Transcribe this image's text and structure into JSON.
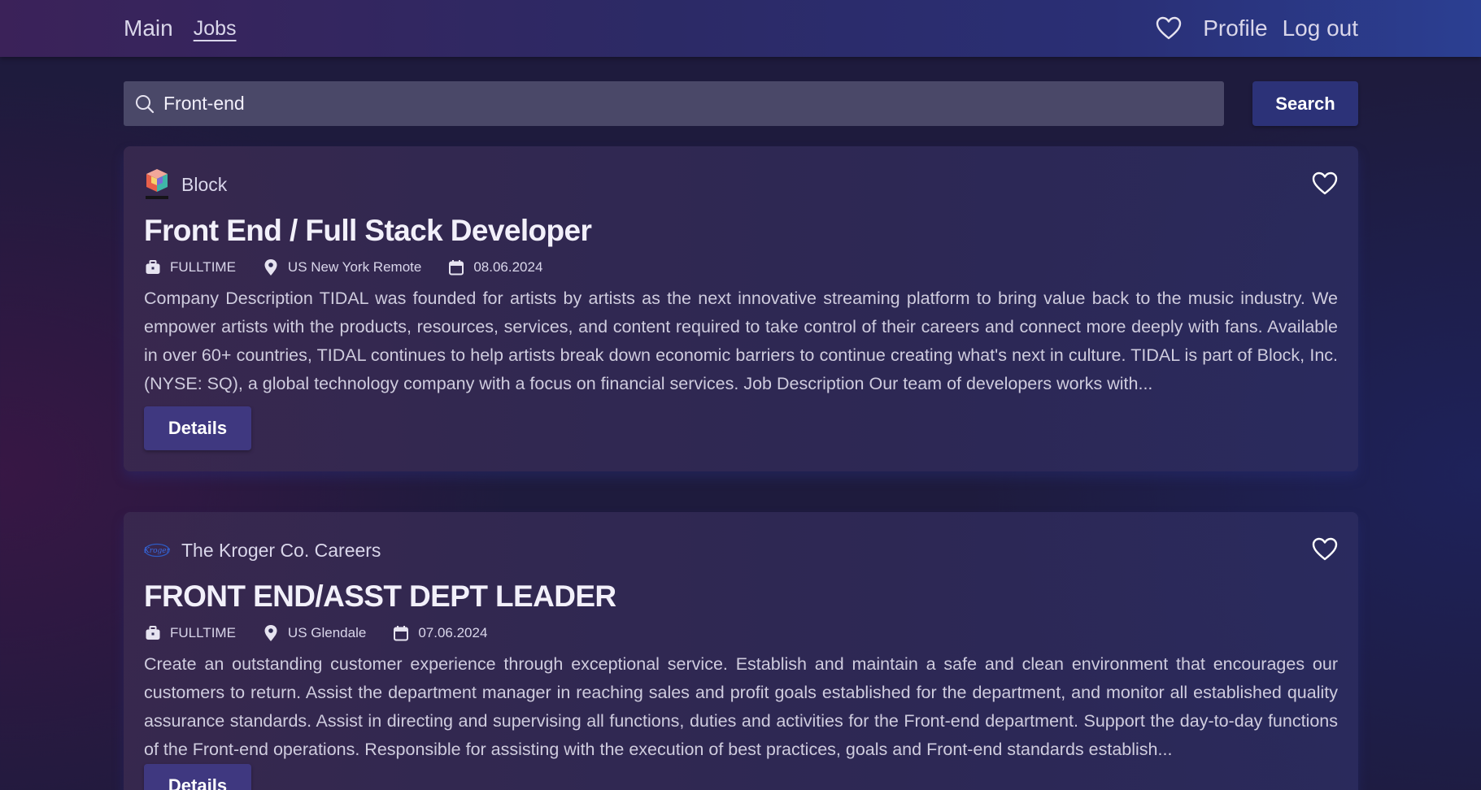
{
  "nav": {
    "main_label": "Main",
    "jobs_label": "Jobs",
    "favorites_icon": "heart-icon",
    "profile_label": "Profile",
    "logout_label": "Log out"
  },
  "search": {
    "value": "Front-end",
    "icon": "search-icon",
    "button_label": "Search"
  },
  "jobs": [
    {
      "company": "Block",
      "logo": "block-logo",
      "title": "Front End / Full Stack Developer",
      "employment_type": "FULLTIME",
      "location": "US New York Remote",
      "date": "08.06.2024",
      "description": "Company Description TIDAL was founded for artists by artists as the next innovative streaming platform to bring value back to the music industry. We empower artists with the products, resources, services, and content required to take control of their careers and connect more deeply with fans. Available in over 60+ countries, TIDAL continues to help artists break down economic barriers to continue creating what's next in culture. TIDAL is part of Block, Inc. (NYSE: SQ), a global technology company with a focus on financial services. Job Description Our team of developers works with...",
      "details_label": "Details"
    },
    {
      "company": "The Kroger Co. Careers",
      "logo": "kroger-logo",
      "title": "FRONT END/ASST DEPT LEADER",
      "employment_type": "FULLTIME",
      "location": "US Glendale",
      "date": "07.06.2024",
      "description": "Create an outstanding customer experience through exceptional service. Establish and maintain a safe and clean environment that encourages our customers to return. Assist the department manager in reaching sales and profit goals established for the department, and monitor all established quality assurance standards. Assist in directing and supervising all functions, duties and activities for the Front-end department. Support the day-to-day functions of the Front-end operations. Responsible for assisting with the execution of best practices, goals and Front-end standards establish...",
      "details_label": "Details"
    }
  ],
  "colors": {
    "navbar_start": "#3b2259",
    "navbar_end": "#2b3f92",
    "search_bg": "#4a4868",
    "search_button": "#2c3278",
    "details_button": "#3f3880",
    "text_primary": "#f2f0fa",
    "text_secondary": "#d9d6ea"
  }
}
